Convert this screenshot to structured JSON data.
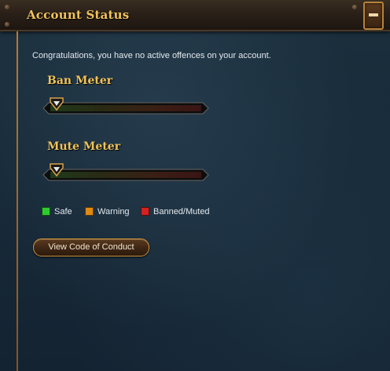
{
  "header": {
    "title": "Account Status",
    "collapse_icon": "minus-icon"
  },
  "intro_text": "Congratulations, you have no active offences on your account.",
  "meters": [
    {
      "title": "Ban Meter",
      "level": 0
    },
    {
      "title": "Mute Meter",
      "level": 0
    }
  ],
  "legend": [
    {
      "label": "Safe",
      "color": "#2ecc2e"
    },
    {
      "label": "Warning",
      "color": "#e08a12"
    },
    {
      "label": "Banned/Muted",
      "color": "#d42222"
    }
  ],
  "conduct_button": {
    "label": "View Code of Conduct"
  },
  "colors": {
    "accent_gold": "#f0c35a",
    "border_orange": "#c07a28"
  }
}
